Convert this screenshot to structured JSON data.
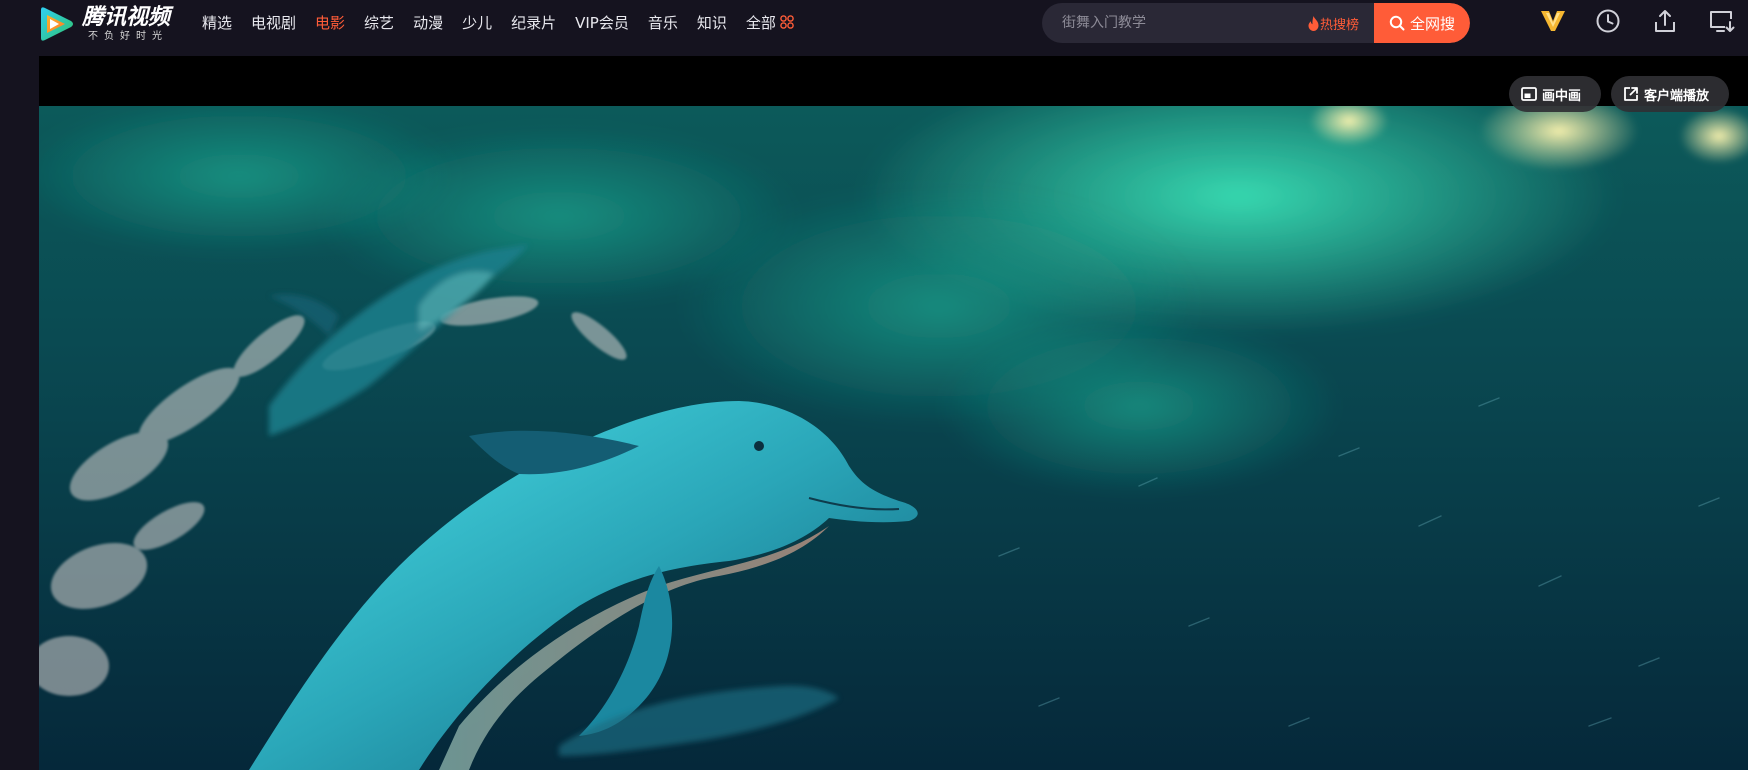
{
  "logo": {
    "title": "腾讯视频",
    "slogan": "不负好时光"
  },
  "nav": {
    "items": [
      "精选",
      "电视剧",
      "电影",
      "综艺",
      "动漫",
      "少儿",
      "纪录片",
      "VIP会员",
      "音乐",
      "知识"
    ],
    "more_label": "全部",
    "active": "电影"
  },
  "search": {
    "placeholder": "街舞入门教学",
    "hot_label": "热搜榜",
    "button_label": "全网搜"
  },
  "player": {
    "pip_label": "画中画",
    "client_play_label": "客户端播放"
  },
  "colors": {
    "accent": "#ff5c38",
    "background": "#15131f",
    "vip_gold": "#f5b731"
  },
  "icons": {
    "header": [
      "vip-icon",
      "history-icon",
      "upload-icon",
      "download-client-icon"
    ],
    "player": [
      "picture-in-picture-icon",
      "external-open-icon"
    ]
  }
}
